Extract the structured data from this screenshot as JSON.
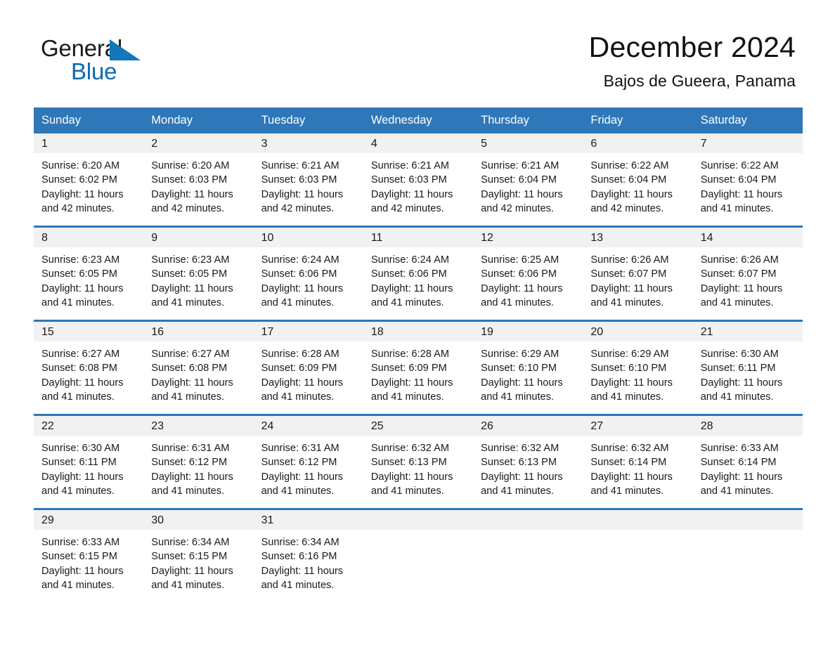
{
  "brand": {
    "name_part1": "General",
    "name_part2": "Blue",
    "flag_icon": "triangle-flag-icon",
    "accent_color": "#1377ba"
  },
  "header": {
    "title": "December 2024",
    "location": "Bajos de Gueera, Panama"
  },
  "calendar": {
    "header_color": "#2e77b8",
    "date_band_color": "#f1f1f1",
    "weekdays": [
      "Sunday",
      "Monday",
      "Tuesday",
      "Wednesday",
      "Thursday",
      "Friday",
      "Saturday"
    ],
    "weeks": [
      [
        {
          "day": "1",
          "sunrise": "Sunrise: 6:20 AM",
          "sunset": "Sunset: 6:02 PM",
          "daylight_line1": "Daylight: 11 hours",
          "daylight_line2": "and 42 minutes."
        },
        {
          "day": "2",
          "sunrise": "Sunrise: 6:20 AM",
          "sunset": "Sunset: 6:03 PM",
          "daylight_line1": "Daylight: 11 hours",
          "daylight_line2": "and 42 minutes."
        },
        {
          "day": "3",
          "sunrise": "Sunrise: 6:21 AM",
          "sunset": "Sunset: 6:03 PM",
          "daylight_line1": "Daylight: 11 hours",
          "daylight_line2": "and 42 minutes."
        },
        {
          "day": "4",
          "sunrise": "Sunrise: 6:21 AM",
          "sunset": "Sunset: 6:03 PM",
          "daylight_line1": "Daylight: 11 hours",
          "daylight_line2": "and 42 minutes."
        },
        {
          "day": "5",
          "sunrise": "Sunrise: 6:21 AM",
          "sunset": "Sunset: 6:04 PM",
          "daylight_line1": "Daylight: 11 hours",
          "daylight_line2": "and 42 minutes."
        },
        {
          "day": "6",
          "sunrise": "Sunrise: 6:22 AM",
          "sunset": "Sunset: 6:04 PM",
          "daylight_line1": "Daylight: 11 hours",
          "daylight_line2": "and 42 minutes."
        },
        {
          "day": "7",
          "sunrise": "Sunrise: 6:22 AM",
          "sunset": "Sunset: 6:04 PM",
          "daylight_line1": "Daylight: 11 hours",
          "daylight_line2": "and 41 minutes."
        }
      ],
      [
        {
          "day": "8",
          "sunrise": "Sunrise: 6:23 AM",
          "sunset": "Sunset: 6:05 PM",
          "daylight_line1": "Daylight: 11 hours",
          "daylight_line2": "and 41 minutes."
        },
        {
          "day": "9",
          "sunrise": "Sunrise: 6:23 AM",
          "sunset": "Sunset: 6:05 PM",
          "daylight_line1": "Daylight: 11 hours",
          "daylight_line2": "and 41 minutes."
        },
        {
          "day": "10",
          "sunrise": "Sunrise: 6:24 AM",
          "sunset": "Sunset: 6:06 PM",
          "daylight_line1": "Daylight: 11 hours",
          "daylight_line2": "and 41 minutes."
        },
        {
          "day": "11",
          "sunrise": "Sunrise: 6:24 AM",
          "sunset": "Sunset: 6:06 PM",
          "daylight_line1": "Daylight: 11 hours",
          "daylight_line2": "and 41 minutes."
        },
        {
          "day": "12",
          "sunrise": "Sunrise: 6:25 AM",
          "sunset": "Sunset: 6:06 PM",
          "daylight_line1": "Daylight: 11 hours",
          "daylight_line2": "and 41 minutes."
        },
        {
          "day": "13",
          "sunrise": "Sunrise: 6:26 AM",
          "sunset": "Sunset: 6:07 PM",
          "daylight_line1": "Daylight: 11 hours",
          "daylight_line2": "and 41 minutes."
        },
        {
          "day": "14",
          "sunrise": "Sunrise: 6:26 AM",
          "sunset": "Sunset: 6:07 PM",
          "daylight_line1": "Daylight: 11 hours",
          "daylight_line2": "and 41 minutes."
        }
      ],
      [
        {
          "day": "15",
          "sunrise": "Sunrise: 6:27 AM",
          "sunset": "Sunset: 6:08 PM",
          "daylight_line1": "Daylight: 11 hours",
          "daylight_line2": "and 41 minutes."
        },
        {
          "day": "16",
          "sunrise": "Sunrise: 6:27 AM",
          "sunset": "Sunset: 6:08 PM",
          "daylight_line1": "Daylight: 11 hours",
          "daylight_line2": "and 41 minutes."
        },
        {
          "day": "17",
          "sunrise": "Sunrise: 6:28 AM",
          "sunset": "Sunset: 6:09 PM",
          "daylight_line1": "Daylight: 11 hours",
          "daylight_line2": "and 41 minutes."
        },
        {
          "day": "18",
          "sunrise": "Sunrise: 6:28 AM",
          "sunset": "Sunset: 6:09 PM",
          "daylight_line1": "Daylight: 11 hours",
          "daylight_line2": "and 41 minutes."
        },
        {
          "day": "19",
          "sunrise": "Sunrise: 6:29 AM",
          "sunset": "Sunset: 6:10 PM",
          "daylight_line1": "Daylight: 11 hours",
          "daylight_line2": "and 41 minutes."
        },
        {
          "day": "20",
          "sunrise": "Sunrise: 6:29 AM",
          "sunset": "Sunset: 6:10 PM",
          "daylight_line1": "Daylight: 11 hours",
          "daylight_line2": "and 41 minutes."
        },
        {
          "day": "21",
          "sunrise": "Sunrise: 6:30 AM",
          "sunset": "Sunset: 6:11 PM",
          "daylight_line1": "Daylight: 11 hours",
          "daylight_line2": "and 41 minutes."
        }
      ],
      [
        {
          "day": "22",
          "sunrise": "Sunrise: 6:30 AM",
          "sunset": "Sunset: 6:11 PM",
          "daylight_line1": "Daylight: 11 hours",
          "daylight_line2": "and 41 minutes."
        },
        {
          "day": "23",
          "sunrise": "Sunrise: 6:31 AM",
          "sunset": "Sunset: 6:12 PM",
          "daylight_line1": "Daylight: 11 hours",
          "daylight_line2": "and 41 minutes."
        },
        {
          "day": "24",
          "sunrise": "Sunrise: 6:31 AM",
          "sunset": "Sunset: 6:12 PM",
          "daylight_line1": "Daylight: 11 hours",
          "daylight_line2": "and 41 minutes."
        },
        {
          "day": "25",
          "sunrise": "Sunrise: 6:32 AM",
          "sunset": "Sunset: 6:13 PM",
          "daylight_line1": "Daylight: 11 hours",
          "daylight_line2": "and 41 minutes."
        },
        {
          "day": "26",
          "sunrise": "Sunrise: 6:32 AM",
          "sunset": "Sunset: 6:13 PM",
          "daylight_line1": "Daylight: 11 hours",
          "daylight_line2": "and 41 minutes."
        },
        {
          "day": "27",
          "sunrise": "Sunrise: 6:32 AM",
          "sunset": "Sunset: 6:14 PM",
          "daylight_line1": "Daylight: 11 hours",
          "daylight_line2": "and 41 minutes."
        },
        {
          "day": "28",
          "sunrise": "Sunrise: 6:33 AM",
          "sunset": "Sunset: 6:14 PM",
          "daylight_line1": "Daylight: 11 hours",
          "daylight_line2": "and 41 minutes."
        }
      ],
      [
        {
          "day": "29",
          "sunrise": "Sunrise: 6:33 AM",
          "sunset": "Sunset: 6:15 PM",
          "daylight_line1": "Daylight: 11 hours",
          "daylight_line2": "and 41 minutes."
        },
        {
          "day": "30",
          "sunrise": "Sunrise: 6:34 AM",
          "sunset": "Sunset: 6:15 PM",
          "daylight_line1": "Daylight: 11 hours",
          "daylight_line2": "and 41 minutes."
        },
        {
          "day": "31",
          "sunrise": "Sunrise: 6:34 AM",
          "sunset": "Sunset: 6:16 PM",
          "daylight_line1": "Daylight: 11 hours",
          "daylight_line2": "and 41 minutes."
        },
        {
          "day": "",
          "sunrise": "",
          "sunset": "",
          "daylight_line1": "",
          "daylight_line2": ""
        },
        {
          "day": "",
          "sunrise": "",
          "sunset": "",
          "daylight_line1": "",
          "daylight_line2": ""
        },
        {
          "day": "",
          "sunrise": "",
          "sunset": "",
          "daylight_line1": "",
          "daylight_line2": ""
        },
        {
          "day": "",
          "sunrise": "",
          "sunset": "",
          "daylight_line1": "",
          "daylight_line2": ""
        }
      ]
    ]
  }
}
